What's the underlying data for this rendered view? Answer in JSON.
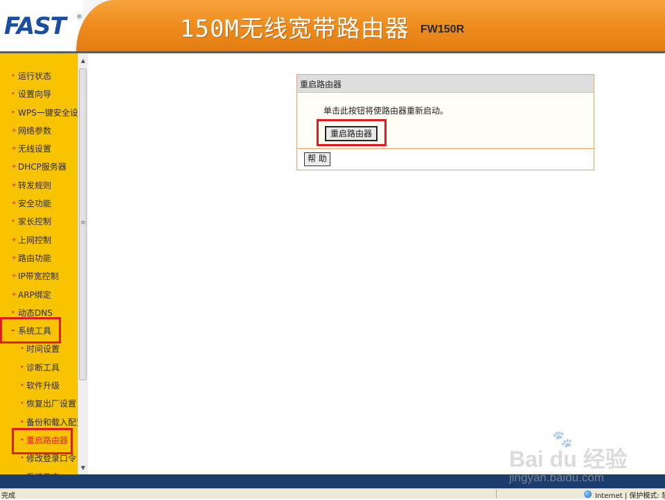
{
  "header": {
    "logo": "FAST",
    "logo_reg": "®",
    "title": "150M无线宽带路由器",
    "model": "FW150R"
  },
  "sidebar": {
    "items": [
      {
        "label": "运行状态",
        "bullet": "•"
      },
      {
        "label": "设置向导",
        "bullet": "•"
      },
      {
        "label": "WPS一键安全设定",
        "bullet": "•"
      },
      {
        "label": "网络参数",
        "bullet": "+"
      },
      {
        "label": "无线设置",
        "bullet": "+"
      },
      {
        "label": "DHCP服务器",
        "bullet": "+"
      },
      {
        "label": "转发规则",
        "bullet": "+"
      },
      {
        "label": "安全功能",
        "bullet": "+"
      },
      {
        "label": "家长控制",
        "bullet": "•"
      },
      {
        "label": "上网控制",
        "bullet": "+"
      },
      {
        "label": "路由功能",
        "bullet": "+"
      },
      {
        "label": "IP带宽控制",
        "bullet": "+"
      },
      {
        "label": "ARP绑定",
        "bullet": "+"
      },
      {
        "label": "动态DNS",
        "bullet": "•"
      },
      {
        "label": "系统工具",
        "bullet": "-"
      }
    ],
    "subitems": [
      {
        "label": "时间设置",
        "bullet": "•"
      },
      {
        "label": "诊断工具",
        "bullet": "•"
      },
      {
        "label": "软件升级",
        "bullet": "•"
      },
      {
        "label": "恢复出厂设置",
        "bullet": "•"
      },
      {
        "label": "备份和载入配置",
        "bullet": "•"
      },
      {
        "label": "重启路由器",
        "bullet": "•"
      },
      {
        "label": "修改登录口令",
        "bullet": "•"
      },
      {
        "label": "系统日志",
        "bullet": "•"
      }
    ]
  },
  "panel": {
    "title": "重启路由器",
    "description": "单击此按钮将使路由器重新启动。",
    "reboot_button": "重启路由器",
    "help_button": "帮 助"
  },
  "statusbar": {
    "left": "完成",
    "right": "Internet | 保护模式: 禁"
  },
  "watermark": {
    "brand": "Bai du 经验",
    "url": "jingyan.baidu.com"
  },
  "colors": {
    "banner_orange": "#ee8a1c",
    "sidebar_yellow": "#f8c300",
    "logo_blue": "#1a4fa0",
    "highlight_red": "#e01b1b",
    "panel_border": "#f0a060"
  }
}
